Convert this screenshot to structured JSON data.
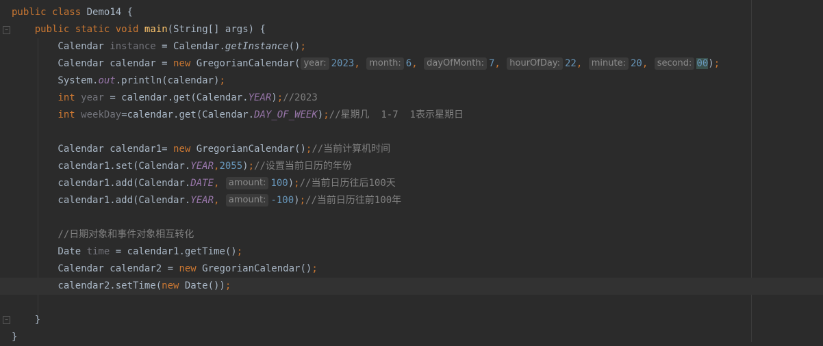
{
  "editor": {
    "lines": [
      {
        "tokens": [
          [
            "kw",
            "public"
          ],
          [
            "pn",
            " "
          ],
          [
            "kw",
            "class"
          ],
          [
            "pn",
            " Demo14 {"
          ]
        ]
      },
      {
        "tokens": [
          [
            "pn",
            "    "
          ],
          [
            "kw",
            "public"
          ],
          [
            "pn",
            " "
          ],
          [
            "kw",
            "static"
          ],
          [
            "pn",
            " "
          ],
          [
            "kw",
            "void"
          ],
          [
            "pn",
            " "
          ],
          [
            "fn",
            "main"
          ],
          [
            "pn",
            "(String[] args) {"
          ]
        ]
      },
      {
        "tokens": [
          [
            "pn",
            "        Calendar "
          ],
          [
            "unused",
            "instance"
          ],
          [
            "pn",
            " = Calendar."
          ],
          [
            "static-m",
            "getInstance"
          ],
          [
            "pn",
            "()"
          ],
          [
            "kw",
            ";"
          ]
        ]
      },
      {
        "tokens": [
          [
            "pn",
            "        Calendar calendar = "
          ],
          [
            "kw",
            "new"
          ],
          [
            "pn",
            " GregorianCalendar("
          ],
          [
            "hint",
            "year:"
          ],
          [
            "num",
            "2023"
          ],
          [
            "kw",
            ","
          ],
          [
            "pn",
            " "
          ],
          [
            "hint",
            "month:"
          ],
          [
            "num",
            "6"
          ],
          [
            "kw",
            ","
          ],
          [
            "pn",
            " "
          ],
          [
            "hint",
            "dayOfMonth:"
          ],
          [
            "num",
            "7"
          ],
          [
            "kw",
            ","
          ],
          [
            "pn",
            " "
          ],
          [
            "hint",
            "hourOfDay:"
          ],
          [
            "num",
            "22"
          ],
          [
            "kw",
            ","
          ],
          [
            "pn",
            " "
          ],
          [
            "hint",
            "minute:"
          ],
          [
            "num",
            "20"
          ],
          [
            "kw",
            ","
          ],
          [
            "pn",
            " "
          ],
          [
            "hint",
            "second:"
          ],
          [
            "hlnum",
            "00"
          ],
          [
            "pn",
            ")"
          ],
          [
            "kw",
            ";"
          ]
        ]
      },
      {
        "tokens": [
          [
            "pn",
            "        System."
          ],
          [
            "field",
            "out"
          ],
          [
            "pn",
            ".println(calendar)"
          ],
          [
            "kw",
            ";"
          ]
        ]
      },
      {
        "tokens": [
          [
            "pn",
            "        "
          ],
          [
            "kw",
            "int"
          ],
          [
            "pn",
            " "
          ],
          [
            "unused",
            "year"
          ],
          [
            "pn",
            " = calendar.get(Calendar."
          ],
          [
            "field",
            "YEAR"
          ],
          [
            "pn",
            ")"
          ],
          [
            "kw",
            ";"
          ],
          [
            "cmt",
            "//2023"
          ]
        ]
      },
      {
        "tokens": [
          [
            "pn",
            "        "
          ],
          [
            "kw",
            "int"
          ],
          [
            "pn",
            " "
          ],
          [
            "unused",
            "weekDay"
          ],
          [
            "pn",
            "=calendar.get(Calendar."
          ],
          [
            "field",
            "DAY_OF_WEEK"
          ],
          [
            "pn",
            ")"
          ],
          [
            "kw",
            ";"
          ],
          [
            "cmt",
            "//星期几  1-7  1表示星期日"
          ]
        ]
      },
      {
        "tokens": []
      },
      {
        "tokens": [
          [
            "pn",
            "        Calendar calendar1= "
          ],
          [
            "kw",
            "new"
          ],
          [
            "pn",
            " GregorianCalendar()"
          ],
          [
            "kw",
            ";"
          ],
          [
            "cmt",
            "//当前计算机时间"
          ]
        ]
      },
      {
        "tokens": [
          [
            "pn",
            "        calendar1.set(Calendar."
          ],
          [
            "field",
            "YEAR"
          ],
          [
            "kw",
            ","
          ],
          [
            "num",
            "2055"
          ],
          [
            "pn",
            ")"
          ],
          [
            "kw",
            ";"
          ],
          [
            "cmt",
            "//设置当前日历的年份"
          ]
        ]
      },
      {
        "tokens": [
          [
            "pn",
            "        calendar1.add(Calendar."
          ],
          [
            "field",
            "DATE"
          ],
          [
            "kw",
            ","
          ],
          [
            "pn",
            " "
          ],
          [
            "hint",
            "amount:"
          ],
          [
            "num",
            "100"
          ],
          [
            "pn",
            ")"
          ],
          [
            "kw",
            ";"
          ],
          [
            "cmt",
            "//当前日历往后100天"
          ]
        ]
      },
      {
        "tokens": [
          [
            "pn",
            "        calendar1.add(Calendar."
          ],
          [
            "field",
            "YEAR"
          ],
          [
            "kw",
            ","
          ],
          [
            "pn",
            " "
          ],
          [
            "hint",
            "amount:"
          ],
          [
            "num",
            "-100"
          ],
          [
            "pn",
            ")"
          ],
          [
            "kw",
            ";"
          ],
          [
            "cmt",
            "//当前日历往前100年"
          ]
        ]
      },
      {
        "tokens": []
      },
      {
        "tokens": [
          [
            "pn",
            "        "
          ],
          [
            "cmt",
            "//日期对象和事件对象相互转化"
          ]
        ]
      },
      {
        "tokens": [
          [
            "pn",
            "        Date "
          ],
          [
            "unused",
            "time"
          ],
          [
            "pn",
            " = calendar1.getTime()"
          ],
          [
            "kw",
            ";"
          ]
        ]
      },
      {
        "tokens": [
          [
            "pn",
            "        Calendar calendar2 = "
          ],
          [
            "kw",
            "new"
          ],
          [
            "pn",
            " GregorianCalendar()"
          ],
          [
            "kw",
            ";"
          ]
        ]
      },
      {
        "tokens": [
          [
            "pn",
            "        calendar2.setTime("
          ],
          [
            "kw",
            "new"
          ],
          [
            "pn",
            " Date())"
          ],
          [
            "kw",
            ";"
          ]
        ]
      },
      {
        "tokens": []
      },
      {
        "tokens": [
          [
            "pn",
            "    }"
          ]
        ]
      },
      {
        "tokens": [
          [
            "pn",
            "}"
          ]
        ]
      }
    ]
  }
}
